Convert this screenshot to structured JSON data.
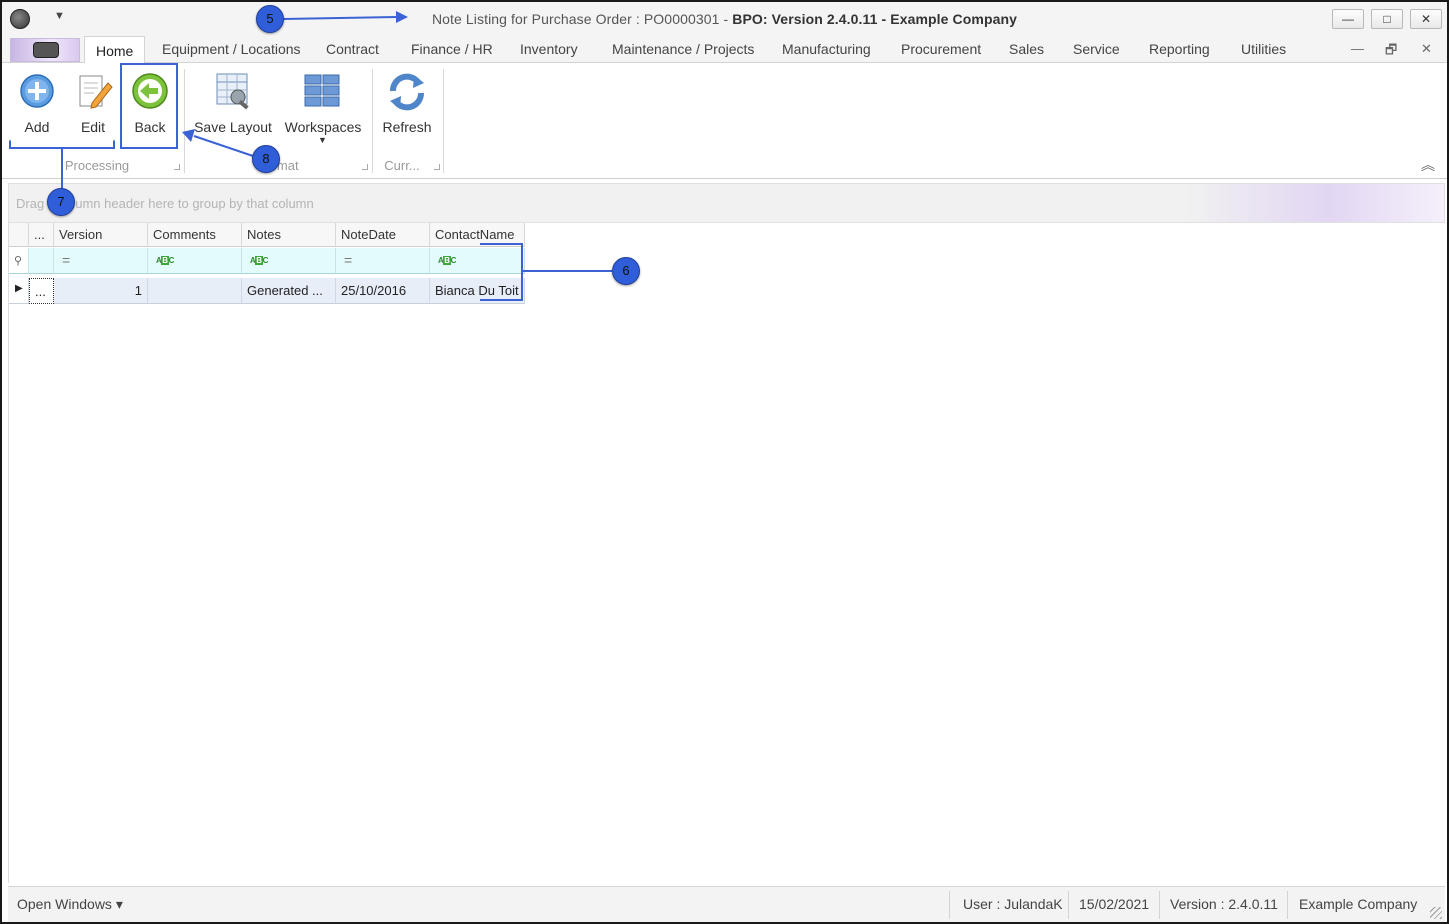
{
  "window": {
    "title_prefix": "Note Listing for Purchase Order : PO0000301 - ",
    "title_bold": "BPO: Version 2.4.0.11 - Example Company",
    "minimize": "—",
    "maximize": "□",
    "close": "✕"
  },
  "qat": {
    "dropdown": "▼"
  },
  "tabs": [
    {
      "label": "Home",
      "active": true
    },
    {
      "label": "Equipment / Locations"
    },
    {
      "label": "Contract"
    },
    {
      "label": "Finance / HR"
    },
    {
      "label": "Inventory"
    },
    {
      "label": "Maintenance / Projects"
    },
    {
      "label": "Manufacturing"
    },
    {
      "label": "Procurement"
    },
    {
      "label": "Sales"
    },
    {
      "label": "Service"
    },
    {
      "label": "Reporting"
    },
    {
      "label": "Utilities"
    }
  ],
  "mdi": {
    "minimize": "—",
    "restore": "🗗",
    "close": "✕"
  },
  "ribbon": {
    "add": "Add",
    "edit": "Edit",
    "back": "Back",
    "save_layout": "Save Layout",
    "workspaces": "Workspaces",
    "refresh": "Refresh",
    "group_processing": "Processing",
    "group_format": "Format",
    "group_currency": "Curr...",
    "collapse": "︽"
  },
  "group_panel": {
    "text": "Drag a column header here to group by that column"
  },
  "grid": {
    "columns": [
      "...",
      "Version",
      "Comments",
      "Notes",
      "NoteDate",
      "ContactName"
    ],
    "rows": [
      {
        "selector": "...",
        "version": "1",
        "comments": "",
        "notes": "Generated ...",
        "note_date": "25/10/2016",
        "contact_name": "Bianca Du Toit"
      }
    ]
  },
  "annotations": {
    "c5": "5",
    "c6": "6",
    "c7": "7",
    "c8": "8"
  },
  "statusbar": {
    "open_windows": "Open Windows ▾",
    "user": "User : JulandaK",
    "date": "15/02/2021",
    "version": "Version : 2.4.0.11",
    "company": "Example Company"
  },
  "colors": {
    "accent": "#3b63d6",
    "filter_row": "#e3fbfb",
    "selected_row": "#e8eef8"
  }
}
